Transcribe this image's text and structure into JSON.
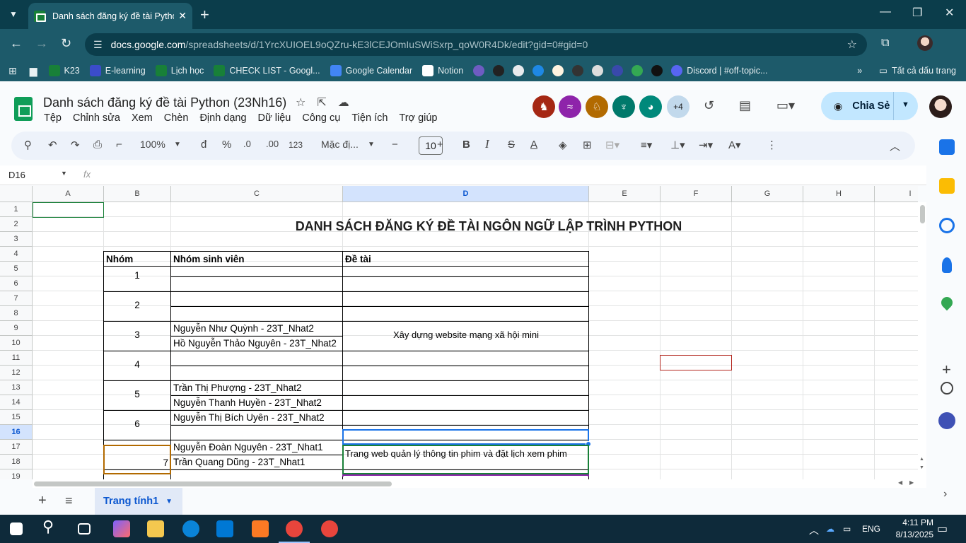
{
  "browser": {
    "tab_title": "Danh sách đăng ký đề tài Pytho",
    "tab_close": "✕",
    "new_tab": "+",
    "url_host": "docs.google.com",
    "url_path": "/spreadsheets/d/1YrcXUIOEL9oQZru-kE3lCEJOmIuSWiSxrp_qoW0R4Dk/edit?gid=0#gid=0",
    "bookmarks": [
      "K23",
      "E-learning",
      "Lịch học",
      "CHECK LIST - Googl...",
      "Google Calendar",
      "Notion",
      "Discord | #off-topic..."
    ],
    "bookmark_all": "Tất cả dấu trang",
    "chevron": "»"
  },
  "sheet": {
    "doc_title": "Danh sách đăng ký đề tài Python (23Nh16)",
    "menu": [
      "Tệp",
      "Chỉnh sửa",
      "Xem",
      "Chèn",
      "Định dạng",
      "Dữ liệu",
      "Công cụ",
      "Tiện ích",
      "Trợ giúp"
    ],
    "collab_more": "+4",
    "share_label": "Chia Sẻ",
    "toolbar": {
      "zoom": "100%",
      "currency": "đ",
      "percent": "%",
      "dec_dec": ".0",
      "dec_inc": ".00",
      "number_format": "123",
      "font": "Mặc đị...",
      "font_size": "10"
    },
    "name_box": "D16",
    "fx": "fx",
    "columns": [
      "A",
      "B",
      "C",
      "D",
      "E",
      "F",
      "G",
      "H",
      "I"
    ],
    "rows": [
      "1",
      "2",
      "3",
      "4",
      "5",
      "6",
      "7",
      "8",
      "9",
      "10",
      "11",
      "12",
      "13",
      "14",
      "15",
      "16",
      "17",
      "18",
      "19"
    ],
    "title": "DANH SÁCH ĐĂNG KÝ ĐỀ TÀI NGÔN NGỮ LẬP TRÌNH PYTHON",
    "headers": {
      "group": "Nhóm",
      "students": "Nhóm sinh viên",
      "topic": "Đề tài"
    },
    "groups": [
      {
        "num": "1",
        "students": [
          "",
          ""
        ],
        "topic": ""
      },
      {
        "num": "2",
        "students": [
          "",
          ""
        ],
        "topic": ""
      },
      {
        "num": "3",
        "students": [
          "Nguyễn Như Quỳnh - 23T_Nhat2",
          "Hồ Nguyễn Thảo Nguyên - 23T_Nhat2"
        ],
        "topic": "Xây dựng website mạng xã hội mini"
      },
      {
        "num": "4",
        "students": [
          "",
          ""
        ],
        "topic": ""
      },
      {
        "num": "5",
        "students": [
          "Trần Thị Phượng - 23T_Nhat2",
          "Nguyễn Thanh Huyền - 23T_Nhat2"
        ],
        "topic": ""
      },
      {
        "num": "6",
        "students": [
          "Nguyễn Thị Bích Uyên - 23T_Nhat2",
          ""
        ],
        "topic": ""
      },
      {
        "num": "7",
        "students": [
          "Nguyễn Đoàn Nguyên - 23T_Nhat1",
          "Trần Quang Dũng - 23T_Nhat1"
        ],
        "topic": "Trang web quản lý thông tin phim và đặt lịch xem phim"
      }
    ],
    "sheet_tab": "Trang tính1",
    "add_sheet": "+",
    "all_sheets": "≡"
  },
  "taskbar": {
    "lang": "ENG",
    "time": "4:11 PM",
    "date": "8/13/2025"
  },
  "colors": {
    "chrome_dark": "#0b3d4b",
    "chrome_mid": "#1d5a6a",
    "selection_blue": "#1a73e8",
    "share_bg": "#c2e7ff"
  }
}
